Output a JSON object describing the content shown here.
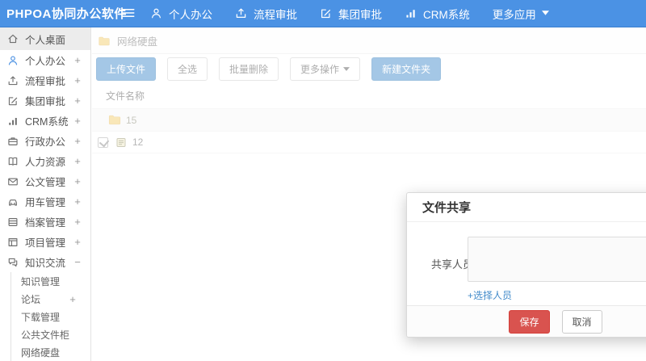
{
  "topbar": {
    "logo": "PHPOA协同办公软件",
    "nav": [
      {
        "label": "个人办公"
      },
      {
        "label": "流程审批"
      },
      {
        "label": "集团审批"
      },
      {
        "label": "CRM系统"
      },
      {
        "label": "更多应用"
      }
    ]
  },
  "sidebar": {
    "items": [
      {
        "label": "个人桌面",
        "expand": ""
      },
      {
        "label": "个人办公",
        "expand": "+"
      },
      {
        "label": "流程审批",
        "expand": "+"
      },
      {
        "label": "集团审批",
        "expand": "+"
      },
      {
        "label": "CRM系统",
        "expand": "+"
      },
      {
        "label": "行政办公",
        "expand": "+"
      },
      {
        "label": "人力资源",
        "expand": "+"
      },
      {
        "label": "公文管理",
        "expand": "+"
      },
      {
        "label": "用车管理",
        "expand": "+"
      },
      {
        "label": "档案管理",
        "expand": "+"
      },
      {
        "label": "项目管理",
        "expand": "+"
      },
      {
        "label": "知识交流",
        "expand": "−"
      }
    ],
    "subitems": [
      {
        "label": "知识管理",
        "expand": ""
      },
      {
        "label": "论坛",
        "expand": "+"
      },
      {
        "label": "下载管理",
        "expand": ""
      },
      {
        "label": "公共文件柜",
        "expand": ""
      },
      {
        "label": "网络硬盘",
        "expand": ""
      }
    ]
  },
  "content": {
    "breadcrumb": {
      "label": "网络硬盘"
    },
    "toolbar": {
      "upload": "上传文件",
      "select_all": "全选",
      "batch_delete": "批量删除",
      "more_actions": "更多操作",
      "new_folder": "新建文件夹"
    },
    "files": {
      "header": "文件名称",
      "rows": [
        {
          "name": "15",
          "type": "folder",
          "checked": false
        },
        {
          "name": "12",
          "type": "file",
          "checked": true
        }
      ]
    }
  },
  "modal": {
    "title": "文件共享",
    "share_label": "共享人员",
    "members_value": "",
    "select_link": "+选择人员",
    "save": "保存",
    "cancel": "取消"
  },
  "colors": {
    "topbar_bg": "#4b92e4",
    "topbar_edge": "#3a7ecf",
    "primary": "#428bca",
    "primary_border": "#357ebd",
    "danger": "#d9534f",
    "danger_border": "#d43f3a",
    "link": "#428bca",
    "folder": "#f2cc6b",
    "active_bg": "#ececec"
  }
}
